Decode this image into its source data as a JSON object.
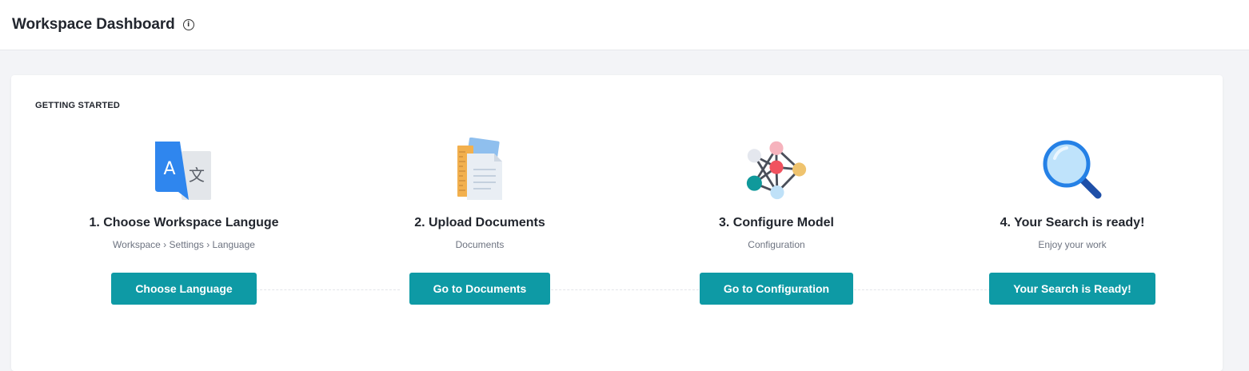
{
  "header": {
    "title": "Workspace Dashboard",
    "info_icon": "info-icon"
  },
  "getting_started": {
    "title": "GETTING STARTED",
    "steps": [
      {
        "title": "1. Choose Workspace Languge",
        "subtitle": "Workspace › Settings › Language",
        "button": "Choose Language",
        "icon": "translate-icon"
      },
      {
        "title": "2. Upload Documents",
        "subtitle": "Documents",
        "button": "Go to Documents",
        "icon": "documents-icon"
      },
      {
        "title": "3. Configure Model",
        "subtitle": "Configuration",
        "button": "Go to Configuration",
        "icon": "network-icon"
      },
      {
        "title": "4. Your Search is ready!",
        "subtitle": "Enjoy your work",
        "button": "Your Search is Ready!",
        "icon": "magnifier-icon"
      }
    ]
  },
  "colors": {
    "accent": "#0e9aa5",
    "background": "#f3f4f7",
    "card": "#ffffff"
  }
}
